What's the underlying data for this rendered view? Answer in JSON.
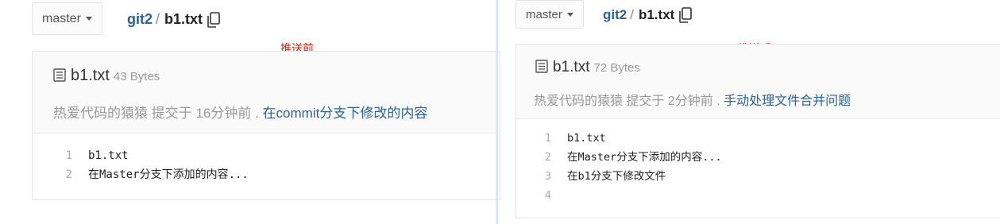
{
  "left": {
    "branch": "master",
    "repo": "git2",
    "separator": "/",
    "file": "b1.txt",
    "note": "推送前",
    "file_name": "b1.txt",
    "file_size": "43 Bytes",
    "commit_prefix": "热爱代码的猿猿 提交于 16分钟前 .",
    "commit_message": "在commit分支下修改的内容",
    "lines": [
      {
        "no": "1",
        "text": "b1.txt"
      },
      {
        "no": "2",
        "text": "在Master分支下添加的内容..."
      }
    ]
  },
  "right": {
    "branch": "master",
    "repo": "git2",
    "separator": "/",
    "file": "b1.txt",
    "note": "推送后",
    "file_name": "b1.txt",
    "file_size": "72 Bytes",
    "commit_prefix": "热爱代码的猿猿 提交于 2分钟前 .",
    "commit_message": "手动处理文件合并问题",
    "lines": [
      {
        "no": "1",
        "text": "b1.txt"
      },
      {
        "no": "2",
        "text": "在Master分支下添加的内容..."
      },
      {
        "no": "3",
        "text": "在b1分支下修改文件"
      },
      {
        "no": "4",
        "text": ""
      }
    ]
  },
  "icons": [
    "caret-down-icon",
    "copy-icon",
    "file-text-icon"
  ]
}
